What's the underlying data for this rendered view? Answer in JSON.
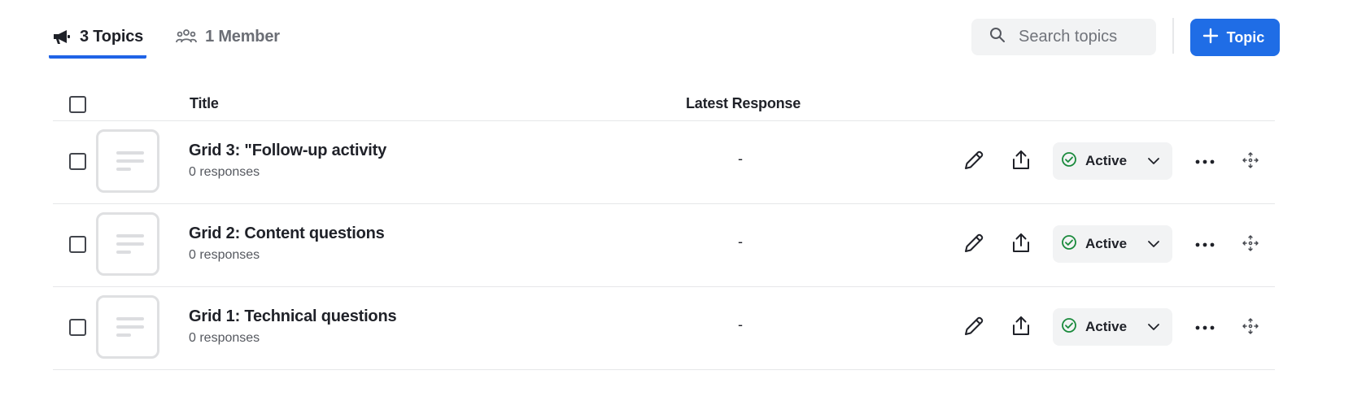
{
  "tabs": [
    {
      "label": "3 Topics",
      "icon": "megaphone-icon",
      "active": true
    },
    {
      "label": "1 Member",
      "icon": "people-icon",
      "active": false
    }
  ],
  "search": {
    "placeholder": "Search topics",
    "value": ""
  },
  "add_button": {
    "label": "Topic",
    "icon": "plus-icon"
  },
  "table": {
    "headers": {
      "title": "Title",
      "latest": "Latest Response"
    },
    "rows": [
      {
        "title": "Grid 3: \"Follow-up activity",
        "responses": "0 responses",
        "latest": "-",
        "status": "Active"
      },
      {
        "title": "Grid 2: Content questions",
        "responses": "0 responses",
        "latest": "-",
        "status": "Active"
      },
      {
        "title": "Grid 1: Technical questions",
        "responses": "0 responses",
        "latest": "-",
        "status": "Active"
      }
    ]
  },
  "colors": {
    "accent": "#1f6de6",
    "active_tab_underline": "#1f63e6",
    "status_ok": "#1a8a3c",
    "muted_bg": "#f2f3f4"
  }
}
